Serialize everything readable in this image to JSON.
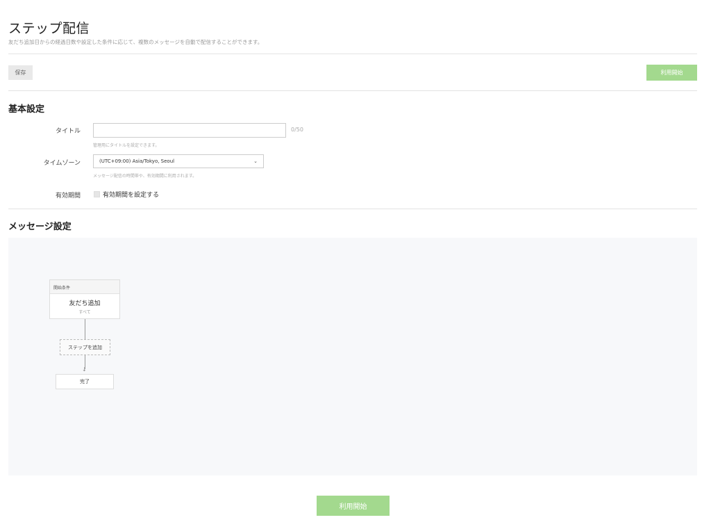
{
  "header": {
    "title": "ステップ配信",
    "subtitle": "友だち追加日からの経過日数や設定した条件に応じて、複数のメッセージを自動で配信することができます。"
  },
  "toolbar": {
    "save_label": "保存",
    "start_label": "利用開始"
  },
  "basic_settings": {
    "section_title": "基本設定",
    "title_field": {
      "label": "タイトル",
      "value": "",
      "counter": "0/50",
      "hint": "管理用にタイトルを設定できます。"
    },
    "timezone_field": {
      "label": "タイムゾーン",
      "selected": "(UTC+09:00) Asia/Tokyo, Seoul",
      "hint": "メッセージ配信の時間帯や、有効期間に利用されます。"
    },
    "validity_field": {
      "label": "有効期間",
      "checkbox_label": "有効期間を設定する",
      "checked": false
    }
  },
  "message_settings": {
    "section_title": "メッセージ設定",
    "start_condition": {
      "header": "開始条件",
      "title": "友だち追加",
      "sub": "すべて"
    },
    "add_step_label": "ステップを追加",
    "done_label": "完了"
  },
  "footer": {
    "start_label": "利用開始"
  },
  "colors": {
    "accent": "#a3d98e",
    "flow_background": "#f7f8fa"
  }
}
